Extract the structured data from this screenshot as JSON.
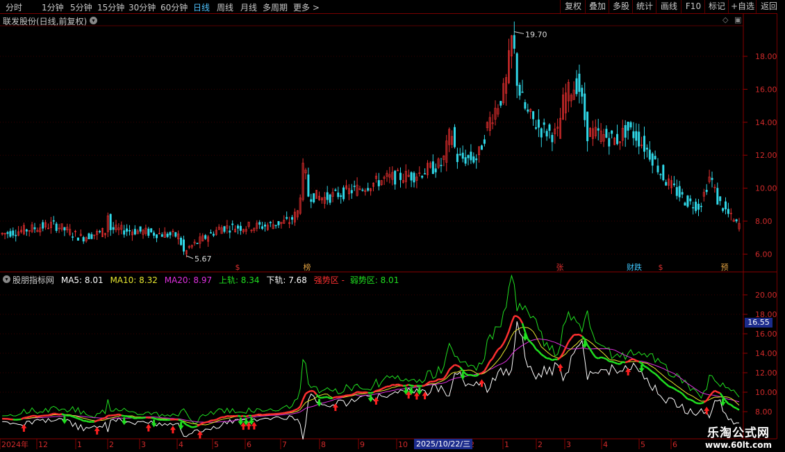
{
  "toolbar": {
    "periods": [
      "分时",
      "1分钟",
      "5分钟",
      "15分钟",
      "30分钟",
      "60分钟",
      "日线",
      "周线",
      "月线",
      "多周期",
      "更多"
    ],
    "active_period": "日线",
    "more_arrow": ">",
    "right_buttons": [
      "复权",
      "叠加",
      "多股",
      "统计",
      "画线",
      "F10",
      "标记",
      "+自选",
      "返回"
    ]
  },
  "main_chart": {
    "title": "联发股份(日线,前复权)",
    "high_label": "19.70",
    "low_label": "5.67",
    "y_ticks": [
      "18.00",
      "16.00",
      "14.00",
      "12.00",
      "10.00",
      "8.00",
      "6.00"
    ],
    "markers": [
      {
        "text": "$",
        "color": "#e03030"
      },
      {
        "text": "榜",
        "color": "#e0a040"
      },
      {
        "text": "张",
        "color": "#e03030"
      },
      {
        "text": "财跌",
        "color": "#40c8ff"
      },
      {
        "text": "$",
        "color": "#e03030"
      },
      {
        "text": "预",
        "color": "#e0a040"
      }
    ]
  },
  "indicator": {
    "name": "股朋指标网",
    "ma5": "MA5: 8.01",
    "ma10": "MA10: 8.32",
    "ma20": "MA20: 8.97",
    "upper": "上轨: 8.34",
    "lower": "下轨: 7.68",
    "strong": "强势区 -",
    "weak": "弱势区: 8.01",
    "y_ticks": [
      "20.00",
      "18.00",
      "16.00",
      "14.00",
      "12.00",
      "10.00",
      "8.00"
    ],
    "current_value": "16.55"
  },
  "x_axis": {
    "labels": [
      "2024年",
      "12",
      "1",
      "2",
      "3",
      "4",
      "5",
      "6",
      "7",
      "8",
      "9",
      "10",
      "2",
      "1",
      "2",
      "3",
      "4",
      "5",
      "6"
    ],
    "cursor_date": "2025/10/22/三"
  },
  "watermark": {
    "line1": "乐淘公式网",
    "line2": "www.60lt.com"
  },
  "colors": {
    "up": "#e83030",
    "down": "#30d8e8",
    "ma5": "#ffffff",
    "ma10": "#e8e830",
    "ma20": "#e030e0",
    "upper": "#20e020",
    "lower": "#ffffff",
    "strong": "#ff3030",
    "weak": "#20e020"
  }
}
